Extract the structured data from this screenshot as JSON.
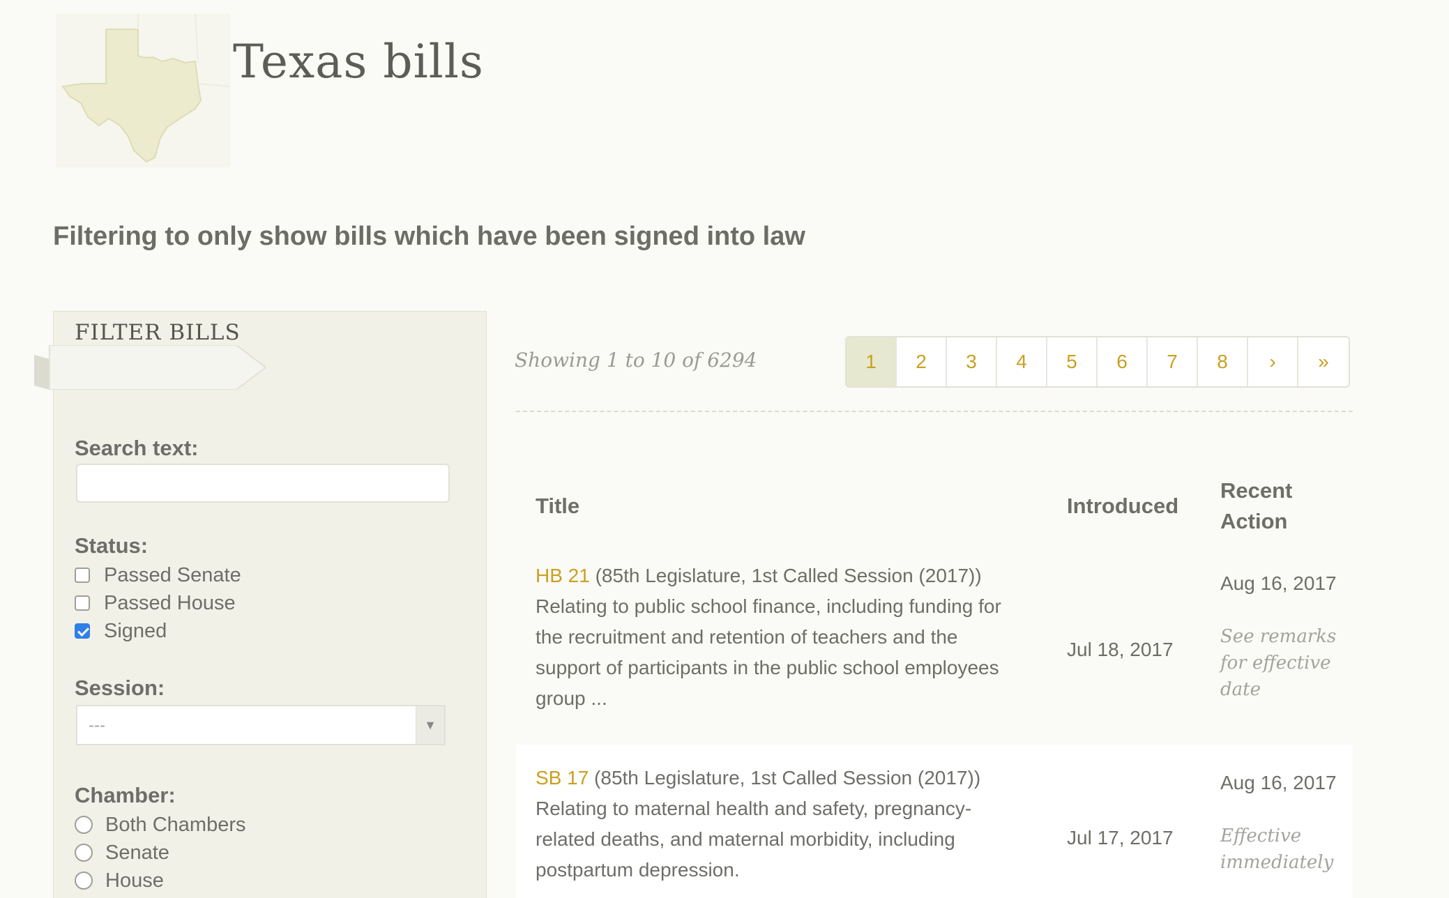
{
  "header": {
    "site_title": "Texas bills",
    "logo_icon": "texas-map-icon"
  },
  "filter_notice": "Filtering to only show bills which have been signed into law",
  "sidebar": {
    "ribbon_label": "FILTER BILLS",
    "search_label": "Search text:",
    "search_value": "",
    "status_label": "Status:",
    "status_options": [
      {
        "label": "Passed Senate",
        "checked": false
      },
      {
        "label": "Passed House",
        "checked": false
      },
      {
        "label": "Signed",
        "checked": true
      }
    ],
    "session_label": "Session:",
    "session_value": "---",
    "chamber_label": "Chamber:",
    "chamber_options": [
      {
        "label": "Both Chambers",
        "selected": false
      },
      {
        "label": "Senate",
        "selected": false
      },
      {
        "label": "House",
        "selected": false
      }
    ]
  },
  "results": {
    "showing": "Showing 1 to 10 of 6294",
    "pages": [
      "1",
      "2",
      "3",
      "4",
      "5",
      "6",
      "7",
      "8",
      "›",
      "»"
    ],
    "active_page": "1"
  },
  "table": {
    "headers": {
      "title": "Title",
      "introduced": "Introduced",
      "recent_action_1": "Recent",
      "recent_action_2": "Action"
    },
    "rows": [
      {
        "bill_id": "HB 21",
        "session": " (85th Legislature, 1st Called Session (2017))",
        "summary": "Relating to public school finance, including funding for the recruitment and retention of teachers and the support of participants in the public school employees group ...",
        "introduced": "Jul 18, 2017",
        "action_date": "Aug 16, 2017",
        "action_note": "See remarks for effective date"
      },
      {
        "bill_id": "SB 17",
        "session": " (85th Legislature, 1st Called Session (2017))",
        "summary": "Relating to maternal health and safety, pregnancy-related deaths, and maternal morbidity, including postpartum depression.",
        "introduced": "Jul 17, 2017",
        "action_date": "Aug 16, 2017",
        "action_note": "Effective immediately"
      }
    ]
  },
  "colors": {
    "background": "#fafaf6",
    "sidebar": "#f2f1e7",
    "link": "#c9a020",
    "active_page": "#e6e8cf",
    "checkbox_checked": "#2f7fe8"
  }
}
